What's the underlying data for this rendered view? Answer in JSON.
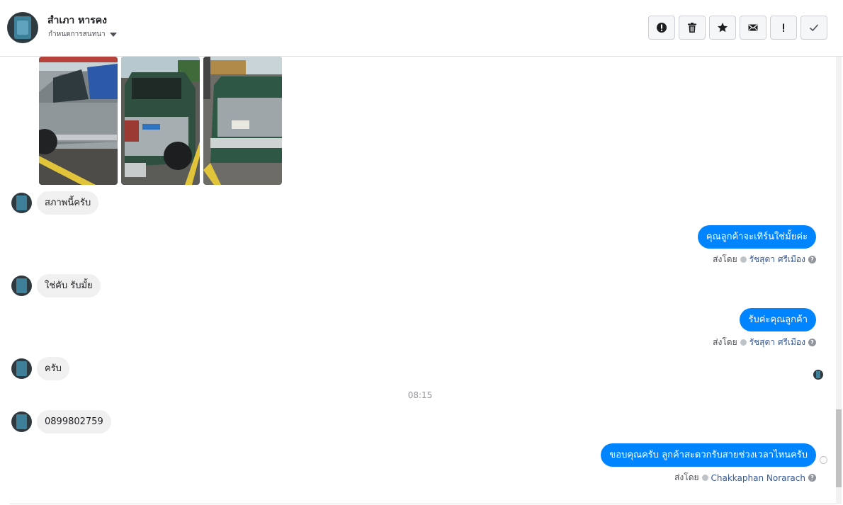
{
  "header": {
    "name": "สำเภา หารคง",
    "subtitle": "กำหนดการสนทนา",
    "actions": [
      {
        "icon": "alert-circle-icon",
        "name": "mark-spam-button"
      },
      {
        "icon": "trash-icon",
        "name": "delete-button"
      },
      {
        "icon": "star-icon",
        "name": "star-button"
      },
      {
        "icon": "envelope-icon",
        "name": "mark-unread-button"
      },
      {
        "icon": "exclamation-icon",
        "name": "follow-up-button"
      },
      {
        "icon": "check-icon",
        "name": "mark-done-button"
      }
    ]
  },
  "messages": {
    "m1": "สภาพนี้ครับ",
    "m2": "คุณลูกค้าจะเทิร์นใช่มั้ยค่ะ",
    "m3": "ใช่คับ รับมั้ย",
    "m4": "รับค่ะคุณลูกค้า",
    "m5": "ครับ",
    "m6": "0899802759",
    "m7": "ขอบคุณครับ ลูกค้าสะดวกรับสายช่วงเวลาไหนครับ"
  },
  "sent_by": {
    "label": "ส่งโดย",
    "agent1": "รัชสุดา ศรีเมือง",
    "agent2": "รัชสุดา ศรีเมือง",
    "agent3": "Chakkaphan Norarach"
  },
  "timestamp": "08:15",
  "colors": {
    "outgoing_bubble": "#0084ff",
    "incoming_bubble": "#f1f0f0",
    "agent_link": "#365899"
  }
}
